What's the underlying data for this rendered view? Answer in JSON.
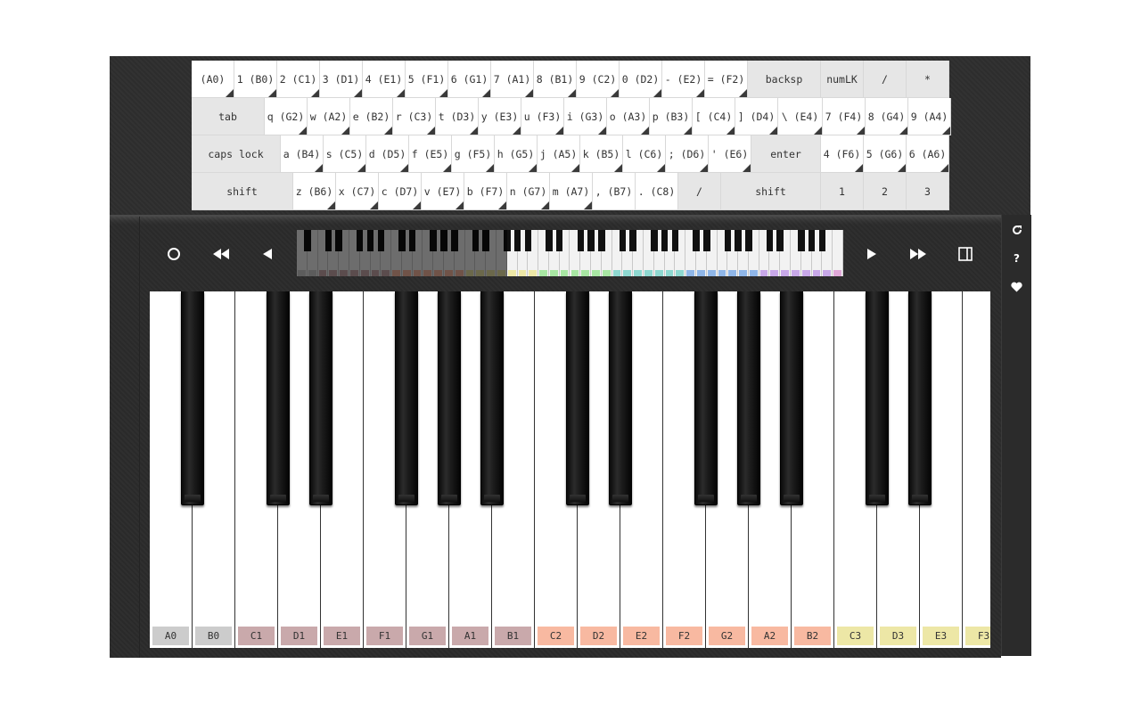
{
  "keyboard": {
    "rows": [
      [
        {
          "label": "(A0)",
          "fn": false,
          "tri": true,
          "w": 48
        },
        {
          "label": "1 (B0)",
          "fn": false,
          "tri": true,
          "w": 48
        },
        {
          "label": "2 (C1)",
          "fn": false,
          "tri": true,
          "w": 48
        },
        {
          "label": "3 (D1)",
          "fn": false,
          "tri": true,
          "w": 48
        },
        {
          "label": "4 (E1)",
          "fn": false,
          "tri": true,
          "w": 48
        },
        {
          "label": "5 (F1)",
          "fn": false,
          "tri": true,
          "w": 48
        },
        {
          "label": "6 (G1)",
          "fn": false,
          "tri": true,
          "w": 48
        },
        {
          "label": "7 (A1)",
          "fn": false,
          "tri": true,
          "w": 48
        },
        {
          "label": "8 (B1)",
          "fn": false,
          "tri": true,
          "w": 48
        },
        {
          "label": "9 (C2)",
          "fn": false,
          "tri": true,
          "w": 48
        },
        {
          "label": "0 (D2)",
          "fn": false,
          "tri": true,
          "w": 48
        },
        {
          "label": "- (E2)",
          "fn": false,
          "tri": true,
          "w": 48
        },
        {
          "label": "= (F2)",
          "fn": false,
          "tri": true,
          "w": 48
        },
        {
          "label": "backsp",
          "fn": true,
          "tri": false,
          "w": 82
        },
        {
          "label": "numLK",
          "fn": true,
          "tri": false,
          "w": 48
        },
        {
          "label": "/",
          "fn": true,
          "tri": false,
          "w": 48
        },
        {
          "label": "*",
          "fn": true,
          "tri": false,
          "w": 48
        }
      ],
      [
        {
          "label": "tab",
          "fn": true,
          "tri": false,
          "w": 82
        },
        {
          "label": "q (G2)",
          "fn": false,
          "tri": true,
          "w": 48
        },
        {
          "label": "w (A2)",
          "fn": false,
          "tri": true,
          "w": 48
        },
        {
          "label": "e (B2)",
          "fn": false,
          "tri": true,
          "w": 48
        },
        {
          "label": "r (C3)",
          "fn": false,
          "tri": true,
          "w": 48
        },
        {
          "label": "t (D3)",
          "fn": false,
          "tri": true,
          "w": 48
        },
        {
          "label": "y (E3)",
          "fn": false,
          "tri": true,
          "w": 48
        },
        {
          "label": "u (F3)",
          "fn": false,
          "tri": true,
          "w": 48
        },
        {
          "label": "i (G3)",
          "fn": false,
          "tri": true,
          "w": 48
        },
        {
          "label": "o (A3)",
          "fn": false,
          "tri": true,
          "w": 48
        },
        {
          "label": "p (B3)",
          "fn": false,
          "tri": true,
          "w": 48
        },
        {
          "label": "[ (C4)",
          "fn": false,
          "tri": true,
          "w": 48
        },
        {
          "label": "] (D4)",
          "fn": false,
          "tri": true,
          "w": 48
        },
        {
          "label": "\\ (E4)",
          "fn": false,
          "tri": true,
          "w": 50
        },
        {
          "label": "7 (F4)",
          "fn": false,
          "tri": true,
          "w": 48
        },
        {
          "label": "8 (G4)",
          "fn": false,
          "tri": true,
          "w": 48
        },
        {
          "label": "9 (A4)",
          "fn": false,
          "tri": true,
          "w": 48
        }
      ],
      [
        {
          "label": "caps lock",
          "fn": true,
          "tri": false,
          "w": 100
        },
        {
          "label": "a (B4)",
          "fn": false,
          "tri": true,
          "w": 48
        },
        {
          "label": "s (C5)",
          "fn": false,
          "tri": true,
          "w": 48
        },
        {
          "label": "d (D5)",
          "fn": false,
          "tri": true,
          "w": 48
        },
        {
          "label": "f (E5)",
          "fn": false,
          "tri": true,
          "w": 48
        },
        {
          "label": "g (F5)",
          "fn": false,
          "tri": true,
          "w": 48
        },
        {
          "label": "h (G5)",
          "fn": false,
          "tri": true,
          "w": 48
        },
        {
          "label": "j (A5)",
          "fn": false,
          "tri": true,
          "w": 48
        },
        {
          "label": "k (B5)",
          "fn": false,
          "tri": true,
          "w": 48
        },
        {
          "label": "l (C6)",
          "fn": false,
          "tri": true,
          "w": 48
        },
        {
          "label": "; (D6)",
          "fn": false,
          "tri": true,
          "w": 48
        },
        {
          "label": "' (E6)",
          "fn": false,
          "tri": true,
          "w": 48
        },
        {
          "label": "enter",
          "fn": true,
          "tri": false,
          "w": 78
        },
        {
          "label": "4 (F6)",
          "fn": false,
          "tri": true,
          "w": 48
        },
        {
          "label": "5 (G6)",
          "fn": false,
          "tri": true,
          "w": 48
        },
        {
          "label": "6 (A6)",
          "fn": false,
          "tri": true,
          "w": 48
        }
      ],
      [
        {
          "label": "shift",
          "fn": true,
          "tri": false,
          "w": 114
        },
        {
          "label": "z (B6)",
          "fn": false,
          "tri": true,
          "w": 48
        },
        {
          "label": "x (C7)",
          "fn": false,
          "tri": true,
          "w": 48
        },
        {
          "label": "c (D7)",
          "fn": false,
          "tri": true,
          "w": 48
        },
        {
          "label": "v (E7)",
          "fn": false,
          "tri": true,
          "w": 48
        },
        {
          "label": "b (F7)",
          "fn": false,
          "tri": true,
          "w": 48
        },
        {
          "label": "n (G7)",
          "fn": false,
          "tri": true,
          "w": 48
        },
        {
          "label": "m (A7)",
          "fn": false,
          "tri": true,
          "w": 48
        },
        {
          "label": ", (B7)",
          "fn": false,
          "tri": false,
          "w": 48
        },
        {
          "label": ". (C8)",
          "fn": false,
          "tri": false,
          "w": 48
        },
        {
          "label": "/",
          "fn": true,
          "tri": false,
          "w": 48
        },
        {
          "label": "shift",
          "fn": true,
          "tri": false,
          "w": 112
        },
        {
          "label": "1",
          "fn": true,
          "tri": false,
          "w": 48
        },
        {
          "label": "2",
          "fn": true,
          "tri": false,
          "w": 48
        },
        {
          "label": "3",
          "fn": true,
          "tri": false,
          "w": 48
        }
      ]
    ]
  },
  "controls": {
    "record_icon": "record-icon",
    "rewind_fast_icon": "rewind-fast-icon",
    "rewind_icon": "rewind-icon",
    "forward_icon": "forward-icon",
    "forward_fast_icon": "forward-fast-icon",
    "panel_toggle_icon": "panel-toggle-icon"
  },
  "sidebar": {
    "reset_icon": "reset-icon",
    "help_label": "?",
    "heart_icon": "heart-icon"
  },
  "minimap": {
    "white_key_count": 52,
    "visible_fraction_start": 0.385
  },
  "piano": {
    "white_keys": [
      {
        "label": "A0",
        "color": "#cccccc"
      },
      {
        "label": "B0",
        "color": "#cccccc"
      },
      {
        "label": "C1",
        "color": "#c9a9ab"
      },
      {
        "label": "D1",
        "color": "#c9a9ab"
      },
      {
        "label": "E1",
        "color": "#c9a9ab"
      },
      {
        "label": "F1",
        "color": "#c9a9ab"
      },
      {
        "label": "G1",
        "color": "#c9a9ab"
      },
      {
        "label": "A1",
        "color": "#c9a9ab"
      },
      {
        "label": "B1",
        "color": "#c9a9ab"
      },
      {
        "label": "C2",
        "color": "#f8b9a1"
      },
      {
        "label": "D2",
        "color": "#f8b9a1"
      },
      {
        "label": "E2",
        "color": "#f8b9a1"
      },
      {
        "label": "F2",
        "color": "#f8b9a1"
      },
      {
        "label": "G2",
        "color": "#f8b9a1"
      },
      {
        "label": "A2",
        "color": "#f8b9a1"
      },
      {
        "label": "B2",
        "color": "#f8b9a1"
      },
      {
        "label": "C3",
        "color": "#ede7a6"
      },
      {
        "label": "D3",
        "color": "#ede7a6"
      },
      {
        "label": "E3",
        "color": "#ede7a6"
      },
      {
        "label": "F3",
        "color": "#ede7a6"
      }
    ],
    "octave_colors": [
      "#cccccc",
      "#c9a9ab",
      "#f8b9a1",
      "#ede7a6",
      "#a8e6a3",
      "#8ed8d0",
      "#8fb6e8",
      "#c8a8e8",
      "#e0a8d8"
    ]
  }
}
